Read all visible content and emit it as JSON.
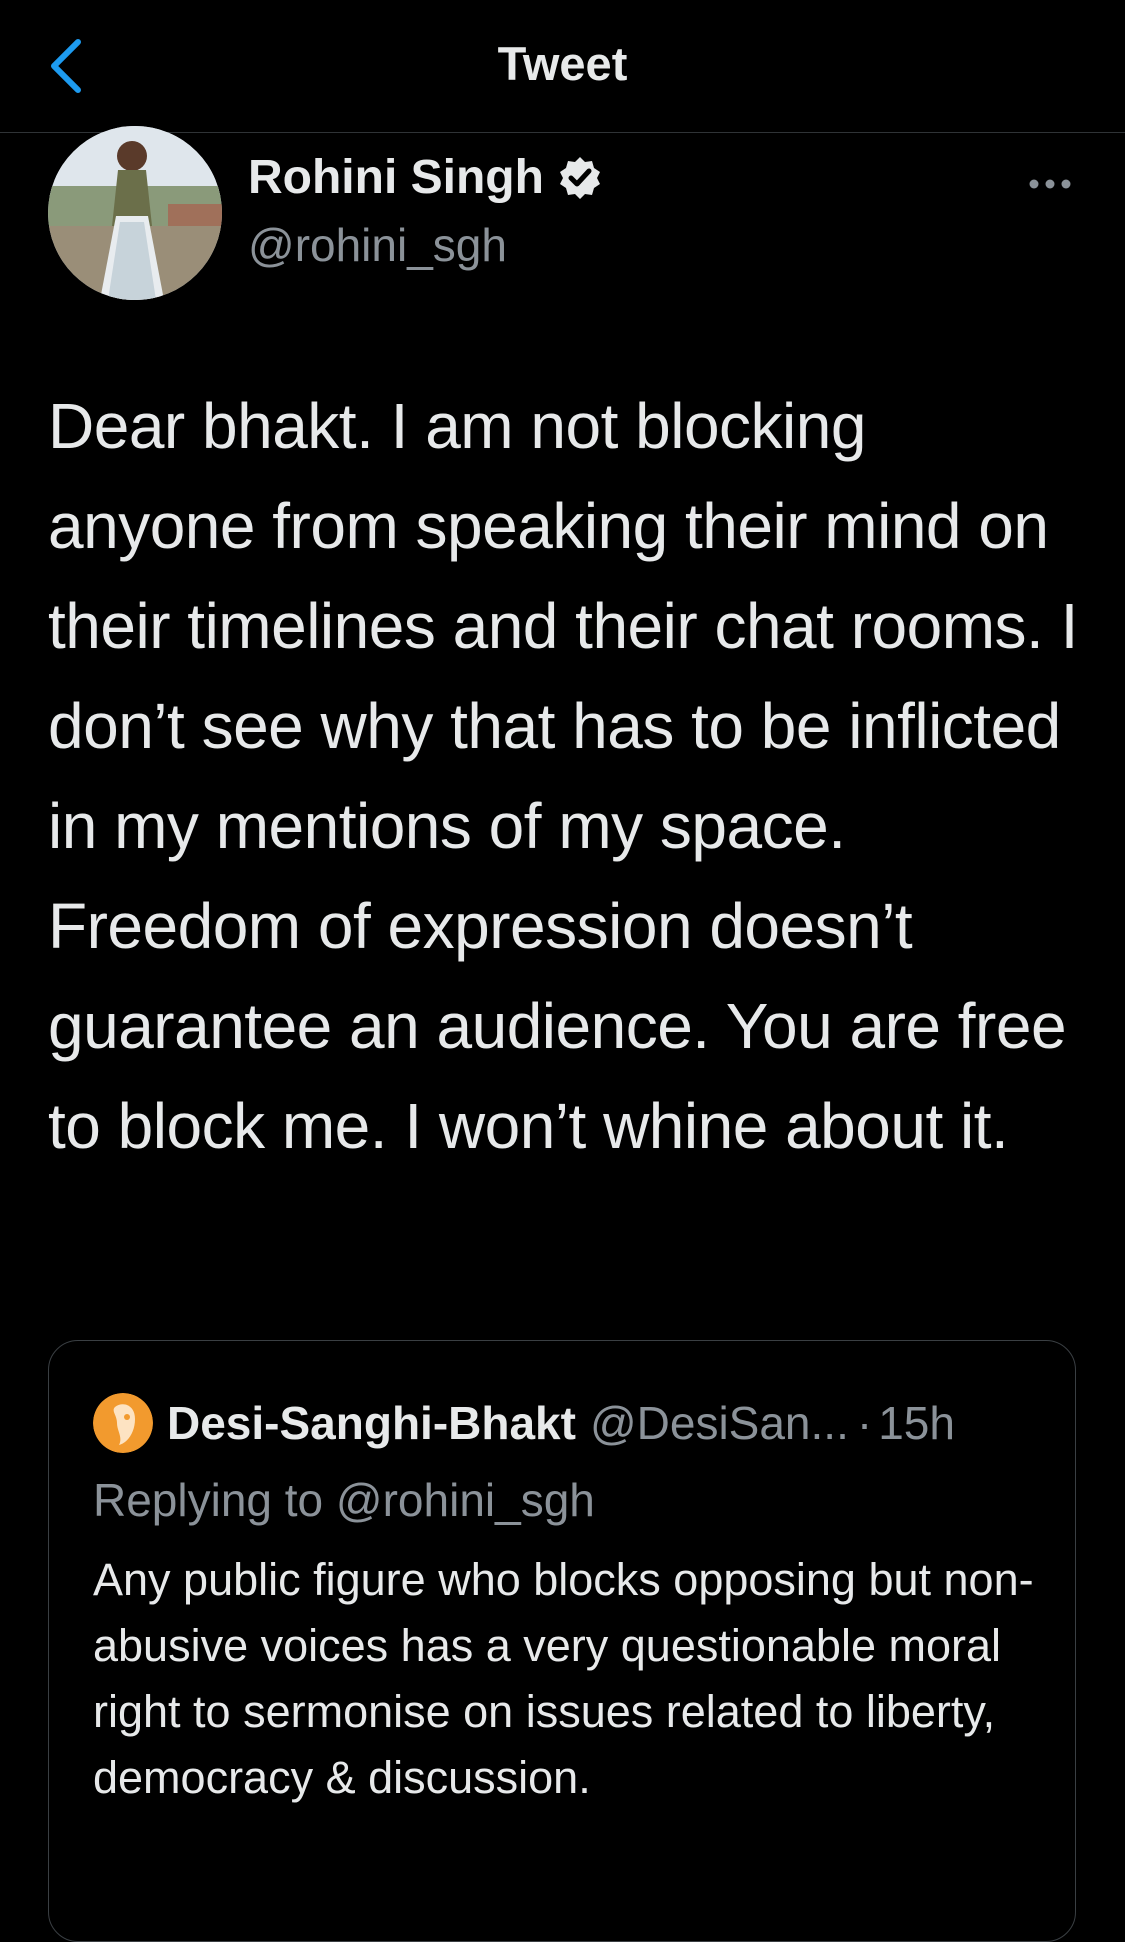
{
  "nav": {
    "title": "Tweet",
    "back_icon": "chevron-left-icon",
    "accent_color": "#1d9bf0"
  },
  "author": {
    "name": "Rohini Singh",
    "handle": "@rohini_sgh",
    "verified": true,
    "more_icon": "ellipsis-icon"
  },
  "tweet": {
    "text": "Dear bhakt. I am not blocking anyone from speaking their mind on their timelines and their chat rooms. I don’t see why that has to be inflicted in my mentions of my space. Freedom of expression doesn’t guarantee an audience. You are free to block me. I won’t whine about it."
  },
  "quoted_tweet": {
    "name": "Desi-Sanghi-Bhakt",
    "handle": "@DesiSan...",
    "separator": "·",
    "time": "15h",
    "replying_to": "Replying to @rohini_sgh",
    "text": "Any public figure who blocks opposing but non-abusive voices has a very questionable moral right to sermonise on issues related to liberty, democracy & discussion."
  }
}
